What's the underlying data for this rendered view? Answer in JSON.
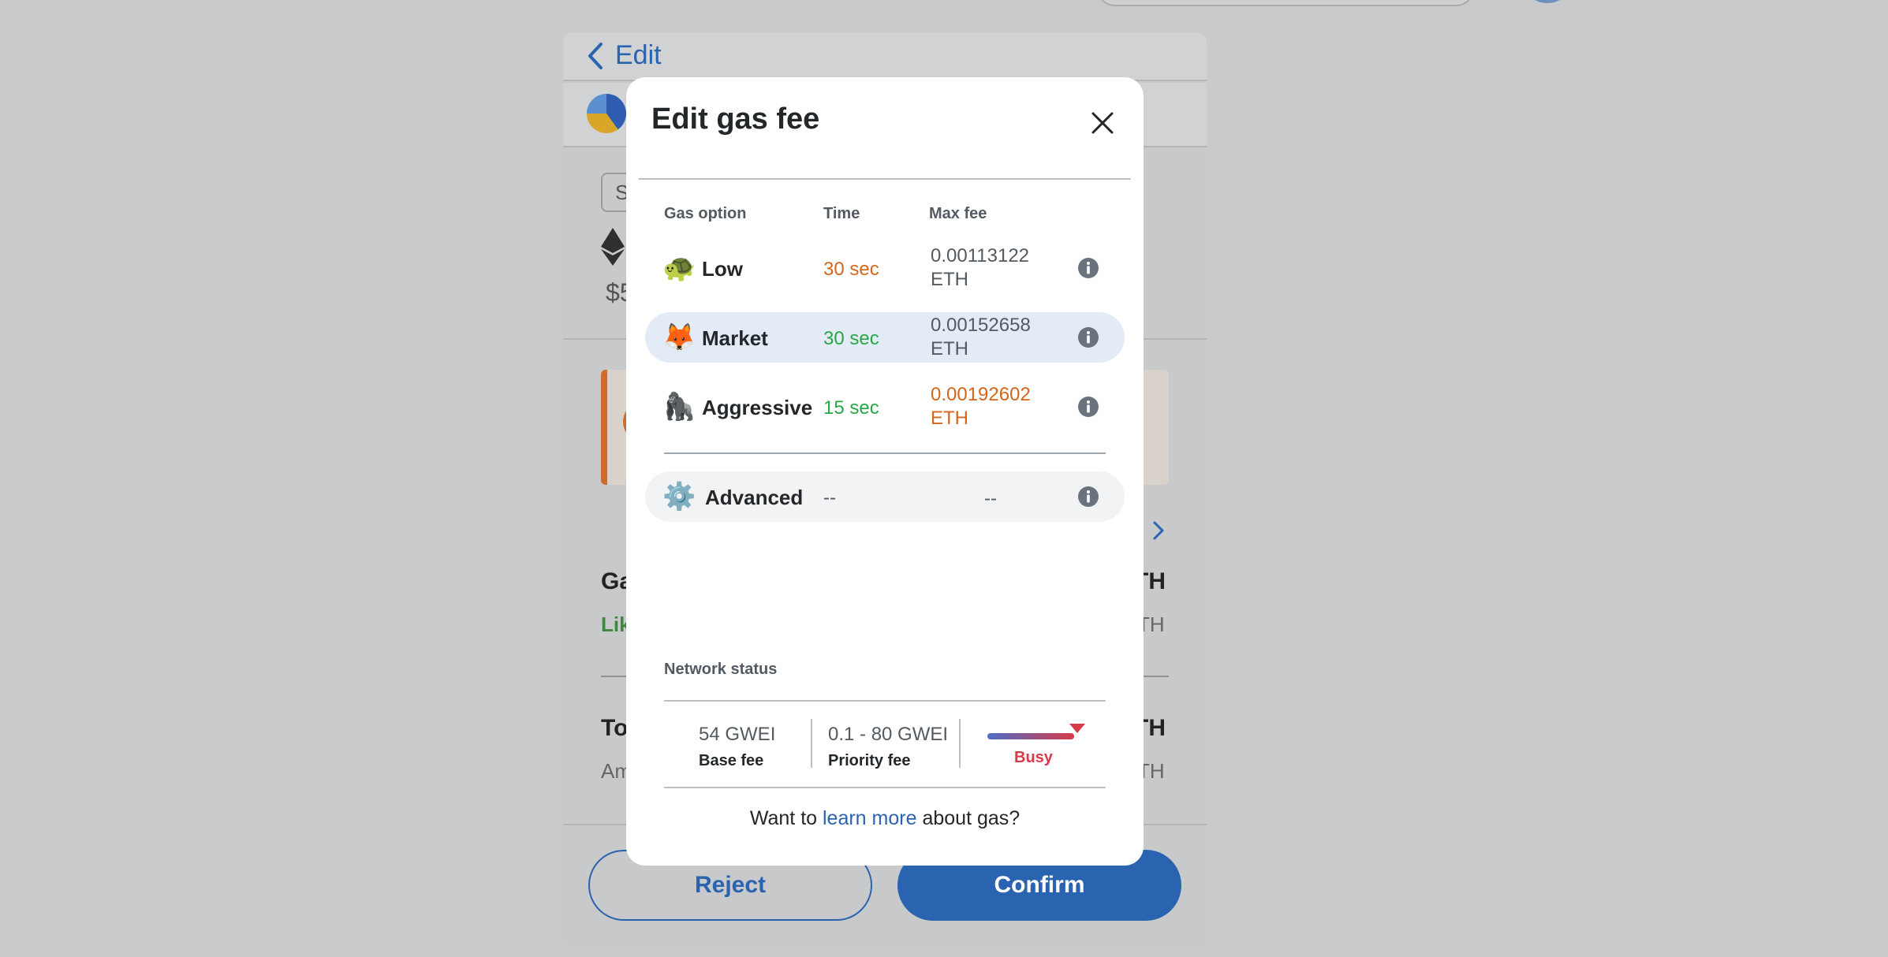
{
  "background": {
    "back_label": "Edit",
    "chip_fragment": "S",
    "price_fragment": "$5",
    "gas_row_fragment": "Ga",
    "likely_fragment": "Lik",
    "total_fragment": "Tot",
    "amount_fragment": "Am",
    "eth_bold_fragment_1": "TH",
    "eth_fragment_1": "TH",
    "eth_bold_fragment_2": "TH",
    "eth_fragment_2": "TH",
    "reject_label": "Reject",
    "confirm_label": "Confirm"
  },
  "modal": {
    "title": "Edit gas fee",
    "columns": {
      "option": "Gas option",
      "time": "Time",
      "max_fee": "Max fee"
    },
    "options": [
      {
        "icon": "🐢",
        "label": "Low",
        "time": "30 sec",
        "fee": "0.00113122",
        "unit": "ETH",
        "time_color": "#d4661b",
        "fee_color": "#535a61",
        "selected": false
      },
      {
        "icon": "🦊",
        "label": "Market",
        "time": "30 sec",
        "fee": "0.00152658",
        "unit": "ETH",
        "time_color": "#28a745",
        "fee_color": "#535a61",
        "selected": true
      },
      {
        "icon": "🦍",
        "label": "Aggressive",
        "time": "15 sec",
        "fee": "0.00192602",
        "unit": "ETH",
        "time_color": "#28a745",
        "fee_color": "#d4661b",
        "selected": false
      }
    ],
    "advanced": {
      "icon": "⚙️",
      "label": "Advanced",
      "time": "--",
      "fee": "--"
    },
    "network_status": {
      "title": "Network status",
      "base_fee_value": "54 GWEI",
      "base_fee_label": "Base fee",
      "priority_fee_value": "0.1 - 80 GWEI",
      "priority_fee_label": "Priority fee",
      "status": "Busy"
    },
    "footer": {
      "prefix": "Want to",
      "link": "learn more",
      "suffix": "about gas?"
    }
  },
  "colors": {
    "accent": "#2a64b0",
    "warning": "#d4661b",
    "success": "#28a745",
    "danger": "#d73a49"
  }
}
